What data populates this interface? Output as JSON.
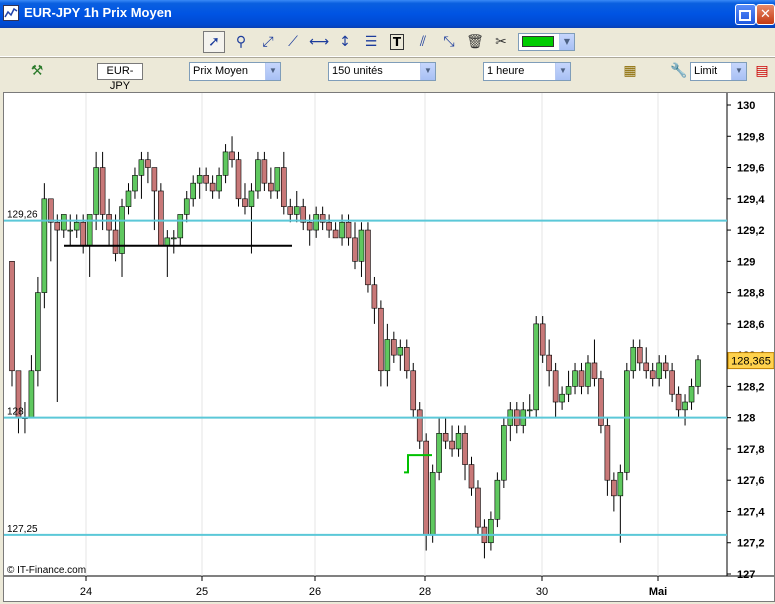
{
  "window": {
    "title": "EUR-JPY 1h Prix Moyen"
  },
  "toolbar": {
    "tools": [
      "pointer-tool",
      "zoom-tool",
      "line-tool",
      "trendline-tool",
      "horizontal-line-tool",
      "vertical-line-tool",
      "fibonacci-tool",
      "text-tool",
      "parallel-lines-tool",
      "extend-line-tool",
      "delete-tool",
      "properties-tool"
    ],
    "line_color": "#00cc00"
  },
  "toolbar2": {
    "symbol": "EUR-JPY",
    "price_type": "Prix Moyen",
    "units": "150 unités",
    "timeframe": "1 heure",
    "order_type": "Limit"
  },
  "chart_data": {
    "type": "candlestick",
    "symbol": "EUR-JPY",
    "ylim": [
      126.95,
      130.1
    ],
    "yticks": [
      "130",
      "129,8",
      "129,6",
      "129,4",
      "129,2",
      "129",
      "128,8",
      "128,6",
      "128,4",
      "128,2",
      "128",
      "127,8",
      "127,6",
      "127,4",
      "127,2",
      "127"
    ],
    "ytick_values": [
      130,
      129.8,
      129.6,
      129.4,
      129.2,
      129,
      128.8,
      128.6,
      128.4,
      128.2,
      128,
      127.8,
      127.6,
      127.4,
      127.2,
      127
    ],
    "xticks": [
      "24",
      "25",
      "26",
      "28",
      "30",
      "Mai"
    ],
    "current_price": "128,365",
    "current_price_value": 128.365,
    "hlines": [
      {
        "label": "129,26",
        "value": 129.26,
        "color": "#5bc8d8"
      },
      {
        "label": "128",
        "value": 128.0,
        "color": "#5bc8d8"
      },
      {
        "label": "127,25",
        "value": 127.25,
        "color": "#5bc8d8"
      }
    ],
    "up_color": "#5fc85f",
    "down_color": "#c87878",
    "watermark": "© IT-Finance.com",
    "candles": [
      [
        129.0,
        129.0,
        128.2,
        128.3
      ],
      [
        128.3,
        128.3,
        127.9,
        128.0
      ],
      [
        128.0,
        128.1,
        127.9,
        128.0
      ],
      [
        128.0,
        128.4,
        128.0,
        128.3
      ],
      [
        128.3,
        128.9,
        128.2,
        128.8
      ],
      [
        128.8,
        129.5,
        128.7,
        129.4
      ],
      [
        129.4,
        129.4,
        129.0,
        129.25
      ],
      [
        129.25,
        129.3,
        128.1,
        129.2
      ],
      [
        129.2,
        129.3,
        129.15,
        129.3
      ],
      [
        129.2,
        129.3,
        129.1,
        129.2
      ],
      [
        129.2,
        129.3,
        129.15,
        129.25
      ],
      [
        129.25,
        129.3,
        129.05,
        129.1
      ],
      [
        129.1,
        129.3,
        128.9,
        129.3
      ],
      [
        129.3,
        129.7,
        129.2,
        129.6
      ],
      [
        129.6,
        129.7,
        129.2,
        129.3
      ],
      [
        129.3,
        129.4,
        129.1,
        129.2
      ],
      [
        129.2,
        129.3,
        129.0,
        129.05
      ],
      [
        129.05,
        129.4,
        128.9,
        129.35
      ],
      [
        129.35,
        129.5,
        129.3,
        129.45
      ],
      [
        129.45,
        129.6,
        129.4,
        129.55
      ],
      [
        129.55,
        129.7,
        129.4,
        129.65
      ],
      [
        129.65,
        129.7,
        129.5,
        129.6
      ],
      [
        129.6,
        129.6,
        129.2,
        129.45
      ],
      [
        129.45,
        129.5,
        129.1,
        129.1
      ],
      [
        129.1,
        129.2,
        128.9,
        129.15
      ],
      [
        129.15,
        129.2,
        129.05,
        129.15
      ],
      [
        129.15,
        129.3,
        129.1,
        129.3
      ],
      [
        129.3,
        129.45,
        129.25,
        129.4
      ],
      [
        129.4,
        129.55,
        129.35,
        129.5
      ],
      [
        129.5,
        129.6,
        129.4,
        129.55
      ],
      [
        129.55,
        129.6,
        129.45,
        129.5
      ],
      [
        129.5,
        129.55,
        129.4,
        129.45
      ],
      [
        129.45,
        129.6,
        129.4,
        129.55
      ],
      [
        129.55,
        129.75,
        129.5,
        129.7
      ],
      [
        129.7,
        129.8,
        129.6,
        129.65
      ],
      [
        129.65,
        129.7,
        129.35,
        129.4
      ],
      [
        129.4,
        129.5,
        129.3,
        129.35
      ],
      [
        129.35,
        129.5,
        129.05,
        129.45
      ],
      [
        129.45,
        129.7,
        129.4,
        129.65
      ],
      [
        129.65,
        129.7,
        129.45,
        129.5
      ],
      [
        129.5,
        129.6,
        129.4,
        129.45
      ],
      [
        129.45,
        129.6,
        129.4,
        129.6
      ],
      [
        129.6,
        129.7,
        129.3,
        129.35
      ],
      [
        129.35,
        129.4,
        129.25,
        129.3
      ],
      [
        129.3,
        129.45,
        129.25,
        129.35
      ],
      [
        129.35,
        129.4,
        129.2,
        129.25
      ],
      [
        129.25,
        129.3,
        129.1,
        129.2
      ],
      [
        129.2,
        129.35,
        129.15,
        129.3
      ],
      [
        129.3,
        129.35,
        129.2,
        129.25
      ],
      [
        129.25,
        129.3,
        129.15,
        129.2
      ],
      [
        129.2,
        129.25,
        129.15,
        129.15
      ],
      [
        129.15,
        129.3,
        129.1,
        129.25
      ],
      [
        129.25,
        129.3,
        129.1,
        129.15
      ],
      [
        129.15,
        129.25,
        128.95,
        129.0
      ],
      [
        129.0,
        129.25,
        128.9,
        129.2
      ],
      [
        129.2,
        129.25,
        128.8,
        128.85
      ],
      [
        128.85,
        128.9,
        128.6,
        128.7
      ],
      [
        128.7,
        128.75,
        128.2,
        128.3
      ],
      [
        128.3,
        128.6,
        128.2,
        128.5
      ],
      [
        128.5,
        128.55,
        128.35,
        128.4
      ],
      [
        128.4,
        128.5,
        128.3,
        128.45
      ],
      [
        128.45,
        128.5,
        128.25,
        128.3
      ],
      [
        128.3,
        128.35,
        128.0,
        128.05
      ],
      [
        128.05,
        128.1,
        127.8,
        127.85
      ],
      [
        127.85,
        127.9,
        127.15,
        127.25
      ],
      [
        127.25,
        127.7,
        127.2,
        127.65
      ],
      [
        127.65,
        128.0,
        127.6,
        127.9
      ],
      [
        127.9,
        128.0,
        127.8,
        127.85
      ],
      [
        127.85,
        127.95,
        127.75,
        127.8
      ],
      [
        127.8,
        127.95,
        127.75,
        127.9
      ],
      [
        127.9,
        127.95,
        127.6,
        127.7
      ],
      [
        127.7,
        127.75,
        127.5,
        127.55
      ],
      [
        127.55,
        127.6,
        127.25,
        127.3
      ],
      [
        127.3,
        127.35,
        127.1,
        127.2
      ],
      [
        127.2,
        127.4,
        127.15,
        127.35
      ],
      [
        127.35,
        127.65,
        127.3,
        127.6
      ],
      [
        127.6,
        128.0,
        127.55,
        127.95
      ],
      [
        127.95,
        128.1,
        127.85,
        128.05
      ],
      [
        128.05,
        128.1,
        127.9,
        127.95
      ],
      [
        127.95,
        128.1,
        127.9,
        128.05
      ],
      [
        128.05,
        128.15,
        128.0,
        128.05
      ],
      [
        128.05,
        128.65,
        128.0,
        128.6
      ],
      [
        128.6,
        128.65,
        128.35,
        128.4
      ],
      [
        128.4,
        128.5,
        128.2,
        128.3
      ],
      [
        128.3,
        128.35,
        128.0,
        128.1
      ],
      [
        128.1,
        128.2,
        128.05,
        128.15
      ],
      [
        128.15,
        128.3,
        128.1,
        128.2
      ],
      [
        128.2,
        128.35,
        128.15,
        128.3
      ],
      [
        128.3,
        128.35,
        128.15,
        128.2
      ],
      [
        128.2,
        128.4,
        128.15,
        128.35
      ],
      [
        128.35,
        128.5,
        128.2,
        128.25
      ],
      [
        128.25,
        128.3,
        127.9,
        127.95
      ],
      [
        127.95,
        128.0,
        127.5,
        127.6
      ],
      [
        127.6,
        127.65,
        127.4,
        127.5
      ],
      [
        127.5,
        127.7,
        127.2,
        127.65
      ],
      [
        127.65,
        128.35,
        127.6,
        128.3
      ],
      [
        128.3,
        128.5,
        128.25,
        128.45
      ],
      [
        128.45,
        128.5,
        128.3,
        128.35
      ],
      [
        128.35,
        128.45,
        128.25,
        128.3
      ],
      [
        128.3,
        128.35,
        128.2,
        128.25
      ],
      [
        128.25,
        128.4,
        128.2,
        128.35
      ],
      [
        128.35,
        128.4,
        128.25,
        128.3
      ],
      [
        128.3,
        128.35,
        128.1,
        128.15
      ],
      [
        128.15,
        128.2,
        128.0,
        128.05
      ],
      [
        128.05,
        128.15,
        127.95,
        128.1
      ],
      [
        128.1,
        128.25,
        128.05,
        128.2
      ],
      [
        128.2,
        128.4,
        128.15,
        128.37
      ]
    ],
    "annotation_line": {
      "value": 129.1,
      "color": "#000000"
    },
    "green_step": {
      "color": "#00c000"
    }
  }
}
